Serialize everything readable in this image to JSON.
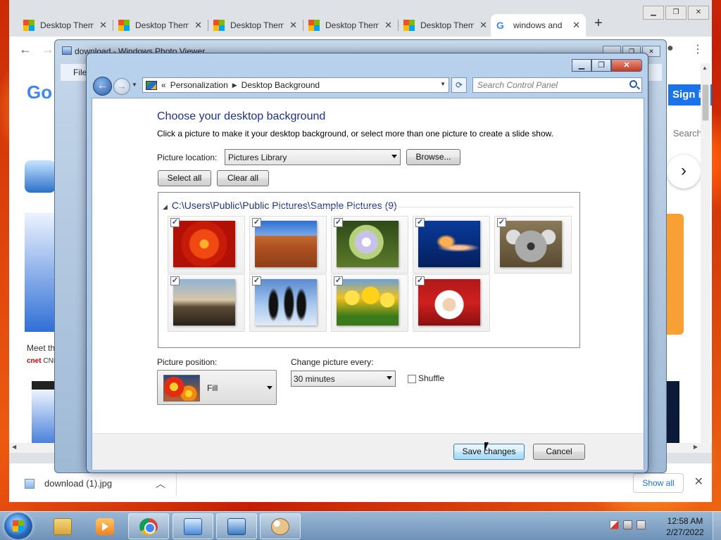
{
  "browser": {
    "tabs": [
      {
        "title": "Desktop Them",
        "icon": "windows-logo-icon"
      },
      {
        "title": "Desktop Them",
        "icon": "windows-logo-icon"
      },
      {
        "title": "Desktop Them",
        "icon": "windows-logo-icon"
      },
      {
        "title": "Desktop Them",
        "icon": "windows-logo-icon"
      },
      {
        "title": "Desktop Them",
        "icon": "windows-logo-icon"
      },
      {
        "title": "windows and",
        "icon": "google-g-icon",
        "active": true
      }
    ],
    "new_tab": "+",
    "page": {
      "logo_partial": "Go",
      "sign_in": "Sign in",
      "search_partial": "Search c",
      "m_partial": "m",
      "article_title_partial": "Meet th",
      "article_source_brand": "cnet",
      "article_source_partial": "CNE"
    },
    "download": {
      "file_name": "download (1).jpg",
      "show_all": "Show all"
    }
  },
  "photo_viewer": {
    "title": "download - Windows Photo Viewer",
    "menu_file": "File"
  },
  "control_panel": {
    "breadcrumb": {
      "root_chevron": "«",
      "items": [
        "Personalization",
        "Desktop Background"
      ]
    },
    "search_placeholder": "Search Control Panel",
    "heading": "Choose your desktop background",
    "description": "Click a picture to make it your desktop background, or select more than one picture to create a slide show.",
    "picture_location": {
      "label": "Picture location:",
      "value": "Pictures Library",
      "browse": "Browse..."
    },
    "select_all": "Select all",
    "clear_all": "Clear all",
    "gallery": {
      "folder": "C:\\Users\\Public\\Public Pictures\\Sample Pictures (9)",
      "pictures": [
        {
          "name": "chrysanthemum",
          "checked": true
        },
        {
          "name": "desert",
          "checked": true
        },
        {
          "name": "hydrangeas",
          "checked": true
        },
        {
          "name": "jellyfish",
          "checked": true
        },
        {
          "name": "koala",
          "checked": true
        },
        {
          "name": "lighthouse",
          "checked": true
        },
        {
          "name": "penguins",
          "checked": true
        },
        {
          "name": "tulips",
          "checked": true
        },
        {
          "name": "santa",
          "checked": true
        }
      ]
    },
    "picture_position": {
      "label": "Picture position:",
      "value": "Fill"
    },
    "change_every": {
      "label": "Change picture every:",
      "value": "30 minutes"
    },
    "shuffle": {
      "label": "Shuffle",
      "checked": false
    },
    "save_button": "Save changes",
    "cancel_button": "Cancel"
  },
  "taskbar": {
    "time": "12:58 AM",
    "date": "2/27/2022",
    "items": [
      "windows-explorer",
      "media-player",
      "google-chrome",
      "control-panel",
      "photo-viewer",
      "paint"
    ]
  }
}
